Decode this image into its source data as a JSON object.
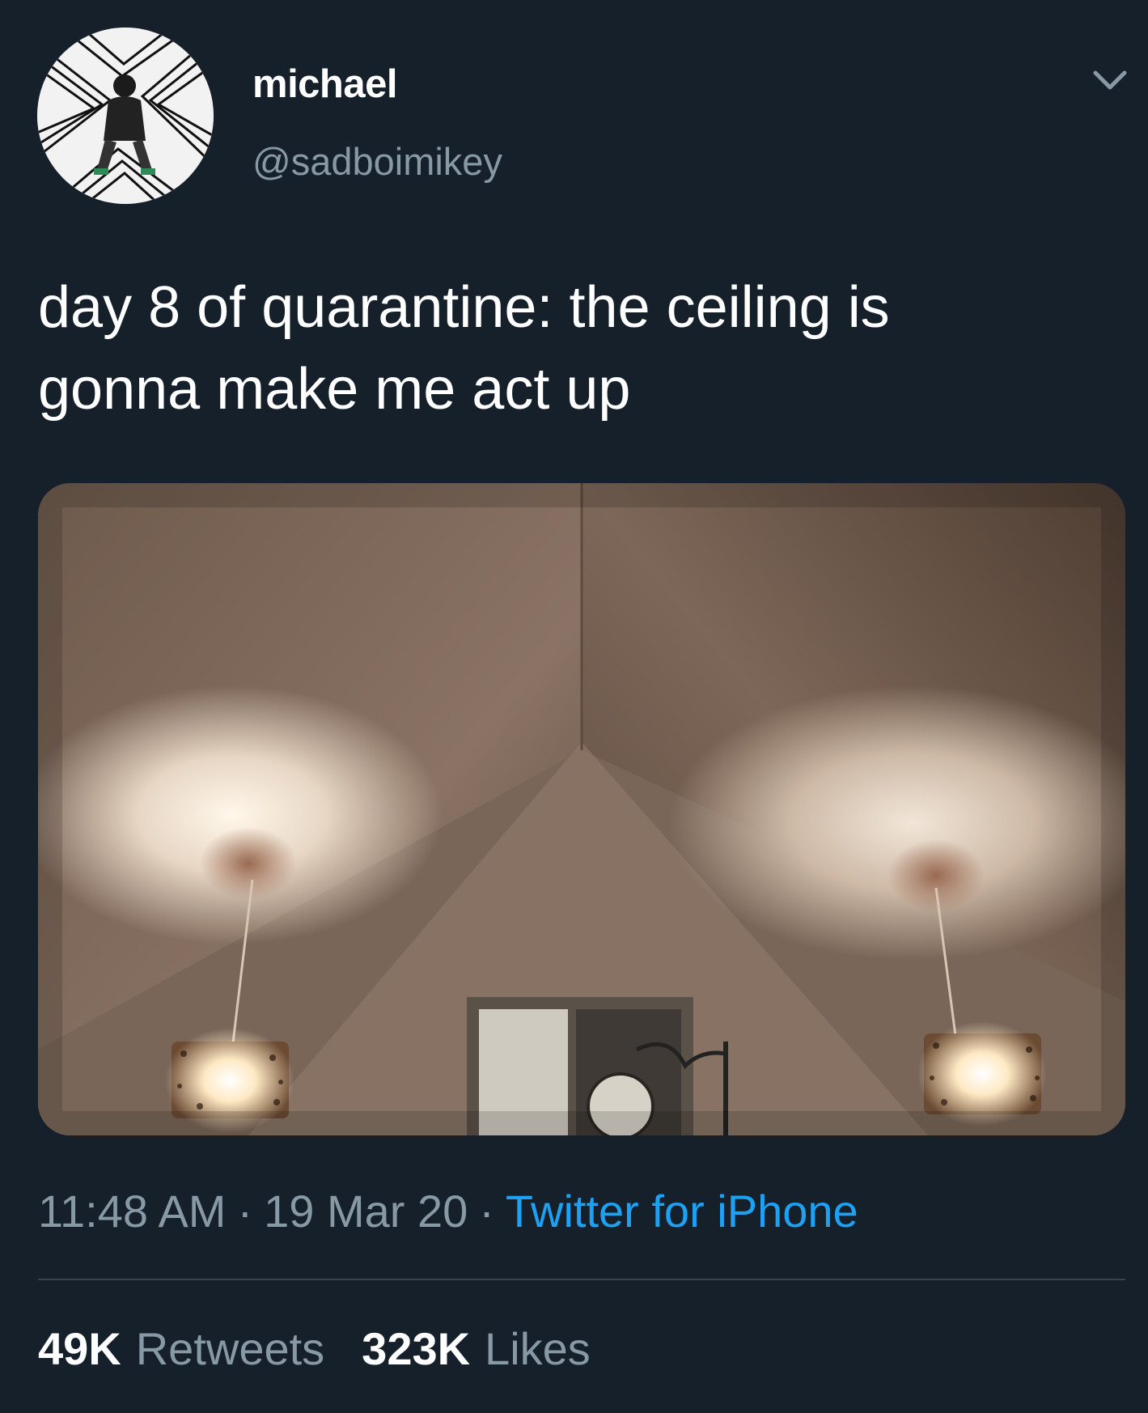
{
  "user": {
    "display_name": "michael",
    "handle": "@sadboimikey",
    "avatar_icon": "user-avatar"
  },
  "tweet": {
    "text_lines": [
      "day 8 of quarantine: the ceiling is",
      "gonna make me act up"
    ],
    "media": {
      "description_icon": "photo-ceiling-pendant-lamps"
    }
  },
  "meta": {
    "time": "11:48 AM",
    "separator": "·",
    "date": "19 Mar 20",
    "source": "Twitter for iPhone"
  },
  "stats": {
    "retweets_count": "49K",
    "retweets_label": "Retweets",
    "likes_count": "323K",
    "likes_label": "Likes"
  },
  "colors": {
    "background": "#15202b",
    "primary_text": "#ffffff",
    "secondary_text": "#8899a6",
    "link": "#1da1f2",
    "divider": "#38444d"
  }
}
